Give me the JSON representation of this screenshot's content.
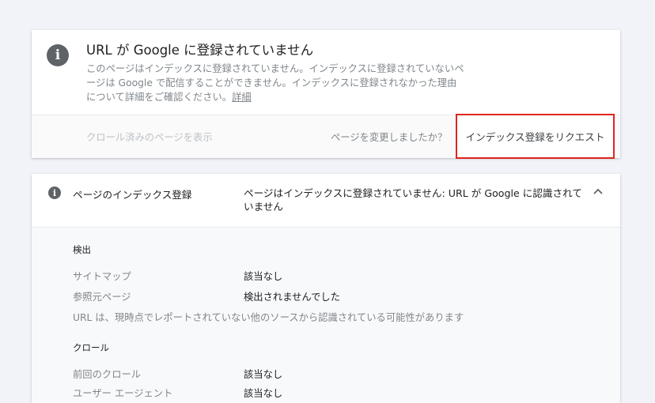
{
  "status_card": {
    "title": "URL が Google に登録されていません",
    "description": "このページはインデックスに登録されていません。インデックスに登録されていないページは Google で配信することができません。インデックスに登録されなかった理由について詳細をご確認ください。",
    "learn_more": "詳細",
    "view_crawled_page": "クロール済みのページを表示",
    "page_changed_prompt": "ページを変更しましたか？",
    "request_indexing": "インデックス登録をリクエスト"
  },
  "coverage": {
    "label": "ページのインデックス登録",
    "value": "ページはインデックスに登録されていません: URL が Google に認識されていません",
    "discovery": {
      "title": "検出",
      "rows": [
        {
          "label": "サイトマップ",
          "value": "該当なし"
        },
        {
          "label": "参照元ページ",
          "value": "検出されませんでした"
        }
      ],
      "note": "URL は、現時点でレポートされていない他のソースから認識されている可能性があります"
    },
    "crawl": {
      "title": "クロール",
      "rows": [
        {
          "label": "前回のクロール",
          "value": "該当なし"
        },
        {
          "label": "ユーザー エージェント",
          "value": "該当なし"
        }
      ]
    }
  },
  "colors": {
    "highlight_border": "#e0251f",
    "background": "#f1f3f9"
  },
  "icons": {
    "status": "info-icon",
    "coverage": "info-icon",
    "collapse": "chevron-up-icon"
  }
}
